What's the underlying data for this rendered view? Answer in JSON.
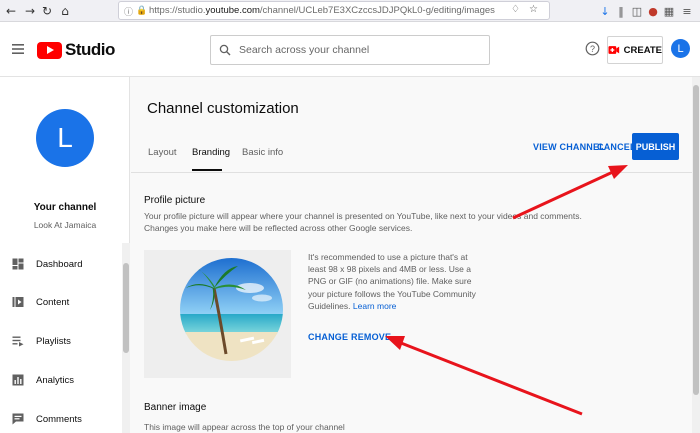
{
  "browser": {
    "url_prefix": "https://studio.",
    "url_domain": "youtube.com",
    "url_path": "/channel/UCLeb7E3XCzccsJDJPQkL0-g/editing/images"
  },
  "header": {
    "logo_text": "Studio",
    "search_placeholder": "Search across your channel",
    "create_label": "CREATE",
    "avatar_letter": "L"
  },
  "sidebar": {
    "avatar_letter": "L",
    "your_channel": "Your channel",
    "channel_name": "Look At Jamaica",
    "items": [
      {
        "label": "Dashboard",
        "icon": "dashboard-icon"
      },
      {
        "label": "Content",
        "icon": "content-icon"
      },
      {
        "label": "Playlists",
        "icon": "playlists-icon"
      },
      {
        "label": "Analytics",
        "icon": "analytics-icon"
      },
      {
        "label": "Comments",
        "icon": "comments-icon"
      }
    ]
  },
  "main": {
    "title": "Channel customization",
    "tabs": [
      "Layout",
      "Branding",
      "Basic info"
    ],
    "active_tab": "Branding",
    "view_channel": "VIEW CHANNEL",
    "cancel": "CANCEL",
    "publish": "PUBLISH",
    "profile": {
      "title": "Profile picture",
      "description": "Your profile picture will appear where your channel is presented on YouTube, like next to your videos and comments. Changes you make here will be reflected across other Google services.",
      "recommendation": "It's recommended to use a picture that's at least 98 x 98 pixels and 4MB or less. Use a PNG or GIF (no animations) file. Make sure your picture follows the YouTube Community Guidelines.",
      "learn_more": "Learn more",
      "change": "CHANGE",
      "remove": "REMOVE"
    },
    "banner": {
      "title": "Banner image",
      "description": "This image will appear across the top of your channel"
    }
  },
  "colors": {
    "accent_blue": "#065fd4",
    "yt_red": "#ff0000",
    "annotation_arrow": "#e8141c"
  }
}
